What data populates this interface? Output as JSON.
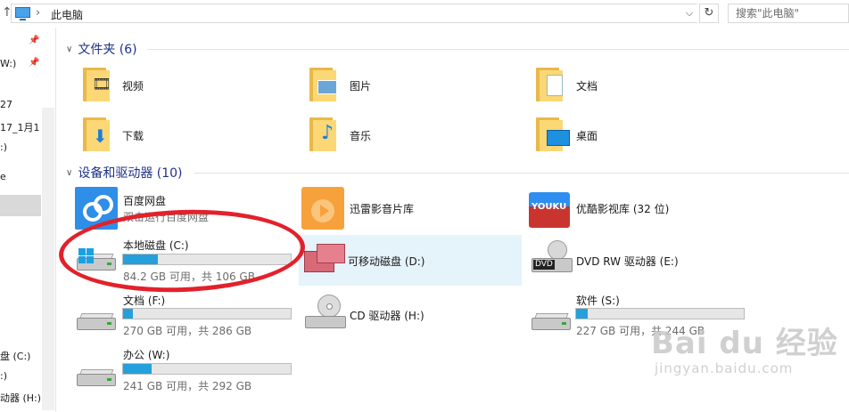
{
  "address_bar": {
    "path_label": "此电脑",
    "search_placeholder": "搜索\"此电脑\""
  },
  "nav_pane": {
    "items": [
      {
        "label": "W:)"
      },
      {
        "label": "27"
      },
      {
        "label": "17_1月1"
      },
      {
        "label": ":)"
      },
      {
        "label": "e"
      },
      {
        "label": "盘 (C:)"
      },
      {
        "label": ":)"
      },
      {
        "label": "动器 (H:)"
      }
    ]
  },
  "folders_section": {
    "title": "文件夹 (6)",
    "items": [
      {
        "label": "视频",
        "icon": "video-folder-icon"
      },
      {
        "label": "图片",
        "icon": "pictures-folder-icon"
      },
      {
        "label": "文档",
        "icon": "documents-folder-icon"
      },
      {
        "label": "下载",
        "icon": "downloads-folder-icon"
      },
      {
        "label": "音乐",
        "icon": "music-folder-icon"
      },
      {
        "label": "桌面",
        "icon": "desktop-folder-icon"
      }
    ]
  },
  "devices_section": {
    "title": "设备和驱动器 (10)",
    "items": [
      {
        "label": "百度网盘",
        "sublabel": "双击运行百度网盘",
        "icon": "baidu-netdisk-icon"
      },
      {
        "label": "迅雷影音片库",
        "icon": "xunlei-video-library-icon"
      },
      {
        "label": "优酷影视库 (32 位)",
        "icon": "youku-icon"
      },
      {
        "label": "本地磁盘 (C:)",
        "sublabel": "84.2 GB 可用，共 106 GB",
        "used_fraction": 0.21,
        "icon": "windows-drive-icon"
      },
      {
        "label": "可移动磁盘 (D:)",
        "icon": "removable-disk-icon"
      },
      {
        "label": "DVD RW 驱动器 (E:)",
        "icon": "dvd-drive-icon"
      },
      {
        "label": "文档 (F:)",
        "sublabel": "270 GB 可用，共 286 GB",
        "used_fraction": 0.06,
        "icon": "hard-drive-icon"
      },
      {
        "label": "CD 驱动器 (H:)",
        "icon": "cd-drive-icon"
      },
      {
        "label": "软件 (S:)",
        "sublabel": "227 GB 可用，共 244 GB",
        "used_fraction": 0.07,
        "icon": "hard-drive-icon"
      },
      {
        "label": "办公 (W:)",
        "sublabel": "241 GB 可用，共 292 GB",
        "used_fraction": 0.17,
        "icon": "hard-drive-icon"
      }
    ]
  },
  "watermark": {
    "main": "Bai du 经验",
    "sub": "jingyan.baidu.com"
  },
  "colors": {
    "accent": "#26a0da",
    "header": "#1e3287",
    "annotation": "#e2212b",
    "folder": "#fbd775"
  }
}
